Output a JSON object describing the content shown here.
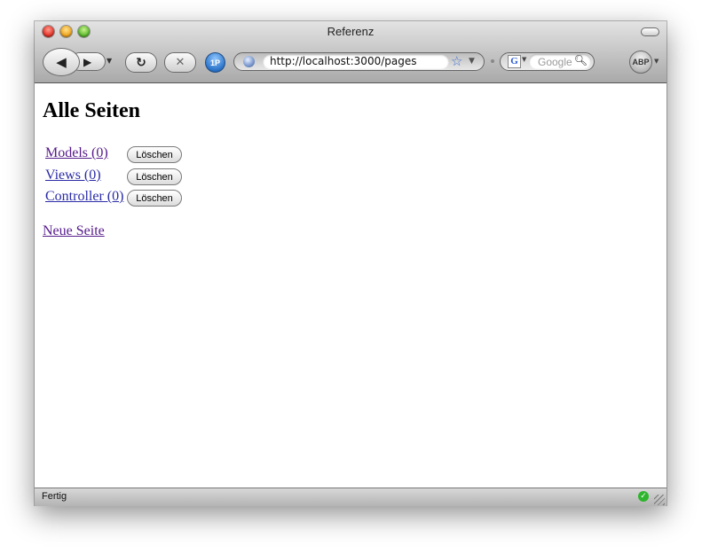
{
  "window": {
    "title": "Referenz"
  },
  "toolbar": {
    "back_icon": "◀",
    "forward_icon": "▶",
    "reload_icon": "↻",
    "stop_icon": "✕",
    "onepassword_label": "1P",
    "url": "http://localhost:3000/pages",
    "search_placeholder": "Google",
    "search_engine_icon": "G",
    "adblock_label": "ABP"
  },
  "page": {
    "heading": "Alle Seiten",
    "items": [
      {
        "label": "Models (0)",
        "delete_label": "Löschen",
        "visited": true
      },
      {
        "label": "Views (0)",
        "delete_label": "Löschen",
        "visited": false
      },
      {
        "label": "Controller (0)",
        "delete_label": "Löschen",
        "visited": false
      }
    ],
    "new_link": "Neue Seite"
  },
  "status": {
    "text": "Fertig"
  },
  "colors": {
    "link": "#2a2ba6",
    "visited_link": "#551a8b",
    "secure": "#2db52d"
  }
}
